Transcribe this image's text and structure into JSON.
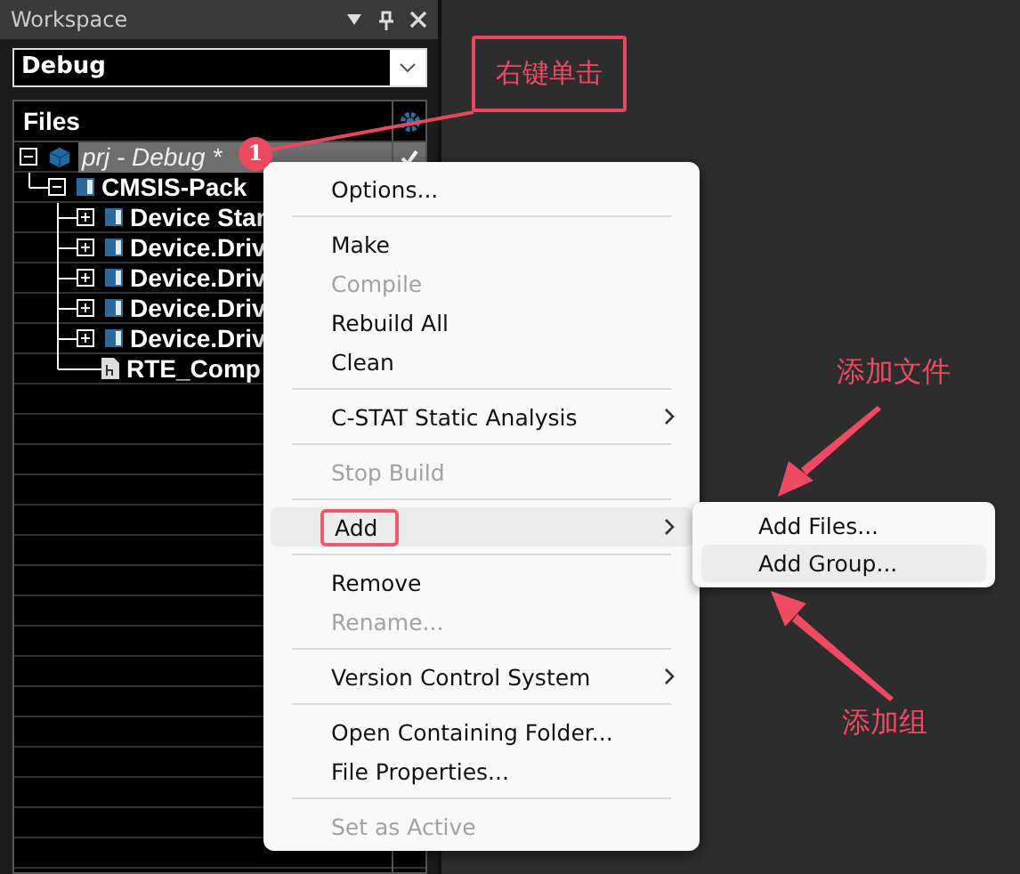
{
  "workspace": {
    "title": "Workspace",
    "configuration": "Debug",
    "files_header": "Files",
    "tree": [
      {
        "label": "prj - Debug *",
        "kind": "project",
        "expanded": true,
        "selected": true,
        "active": true,
        "children": [
          {
            "label": "CMSIS-Pack",
            "kind": "group",
            "expanded": true,
            "children": [
              {
                "label": "Device Star",
                "kind": "group",
                "expanded": false
              },
              {
                "label": "Device.Driv",
                "kind": "group",
                "expanded": false
              },
              {
                "label": "Device.Driv",
                "kind": "group",
                "expanded": false
              },
              {
                "label": "Device.Driv",
                "kind": "group",
                "expanded": false
              },
              {
                "label": "Device.Driv",
                "kind": "group",
                "expanded": false
              },
              {
                "label": "RTE_Comp",
                "kind": "file"
              }
            ]
          }
        ]
      }
    ]
  },
  "context_menu": {
    "items": [
      {
        "kind": "item",
        "label": "Options...",
        "disabled": false,
        "submenu": false,
        "selected": false,
        "outlined": false
      },
      {
        "kind": "separator"
      },
      {
        "kind": "item",
        "label": "Make",
        "disabled": false,
        "submenu": false,
        "selected": false,
        "outlined": false
      },
      {
        "kind": "item",
        "label": "Compile",
        "disabled": true,
        "submenu": false,
        "selected": false,
        "outlined": false
      },
      {
        "kind": "item",
        "label": "Rebuild All",
        "disabled": false,
        "submenu": false,
        "selected": false,
        "outlined": false
      },
      {
        "kind": "item",
        "label": "Clean",
        "disabled": false,
        "submenu": false,
        "selected": false,
        "outlined": false
      },
      {
        "kind": "separator"
      },
      {
        "kind": "item",
        "label": "C-STAT Static Analysis",
        "disabled": false,
        "submenu": true,
        "selected": false,
        "outlined": false
      },
      {
        "kind": "separator"
      },
      {
        "kind": "item",
        "label": "Stop Build",
        "disabled": true,
        "submenu": false,
        "selected": false,
        "outlined": false
      },
      {
        "kind": "separator"
      },
      {
        "kind": "item",
        "label": "Add",
        "disabled": false,
        "submenu": true,
        "selected": true,
        "outlined": true
      },
      {
        "kind": "separator"
      },
      {
        "kind": "item",
        "label": "Remove",
        "disabled": false,
        "submenu": false,
        "selected": false,
        "outlined": false
      },
      {
        "kind": "item",
        "label": "Rename...",
        "disabled": true,
        "submenu": false,
        "selected": false,
        "outlined": false
      },
      {
        "kind": "separator"
      },
      {
        "kind": "item",
        "label": "Version Control System",
        "disabled": false,
        "submenu": true,
        "selected": false,
        "outlined": false
      },
      {
        "kind": "separator"
      },
      {
        "kind": "item",
        "label": "Open Containing Folder...",
        "disabled": false,
        "submenu": false,
        "selected": false,
        "outlined": false
      },
      {
        "kind": "item",
        "label": "File Properties...",
        "disabled": false,
        "submenu": false,
        "selected": false,
        "outlined": false
      },
      {
        "kind": "separator"
      },
      {
        "kind": "item",
        "label": "Set as Active",
        "disabled": true,
        "submenu": false,
        "selected": false,
        "outlined": false
      }
    ]
  },
  "submenu": {
    "items": [
      {
        "label": "Add Files...",
        "selected": false
      },
      {
        "label": "Add Group...",
        "selected": true
      }
    ]
  },
  "annotations": {
    "step_badge": "1",
    "callout": "右键单击",
    "label_files": "添加文件",
    "label_group": "添加组"
  }
}
